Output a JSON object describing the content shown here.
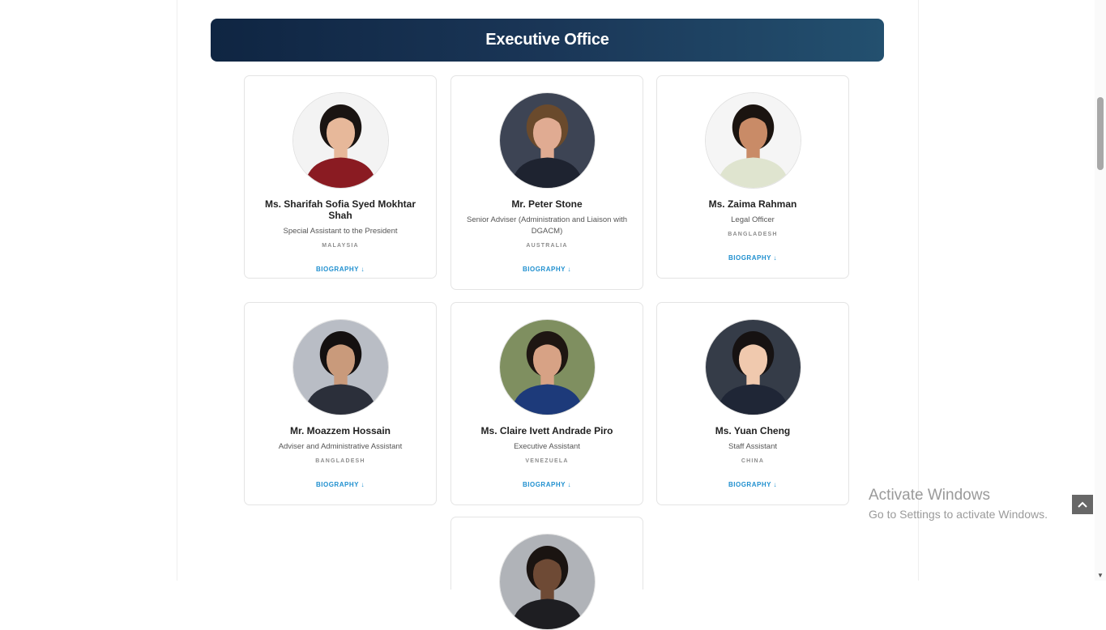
{
  "section": {
    "title": "Executive Office"
  },
  "people": [
    {
      "name": "Ms. Sharifah Sofia Syed Mokhtar Shah",
      "role": "Special Assistant to the President",
      "country": "MALAYSIA",
      "bio_label": "BIOGRAPHY ↓",
      "bg": "#f3f3f3",
      "skin": "#e7b89a",
      "hair": "#1a1412",
      "shirt": "#8a1b22"
    },
    {
      "name": "Mr. Peter Stone",
      "role": "Senior Adviser (Administration and Liaison with DGACM)",
      "country": "AUSTRALIA",
      "bio_label": "BIOGRAPHY ↓",
      "bg": "#3d4454",
      "skin": "#e0ab92",
      "hair": "#6a4a2c",
      "shirt": "#1e2330"
    },
    {
      "name": "Ms. Zaima Rahman",
      "role": "Legal Officer",
      "country": "BANGLADESH",
      "bio_label": "BIOGRAPHY ↓",
      "bg": "#f5f5f5",
      "skin": "#c98b67",
      "hair": "#1b1410",
      "shirt": "#dfe4cf"
    },
    {
      "name": "Mr. Moazzem Hossain",
      "role": "Adviser and Administrative Assistant",
      "country": "BANGLADESH",
      "bio_label": "BIOGRAPHY ↓",
      "bg": "#b9bdc5",
      "skin": "#c99a7b",
      "hair": "#141010",
      "shirt": "#2b2f3a"
    },
    {
      "name": "Ms. Claire Ivett Andrade Piro",
      "role": "Executive Assistant",
      "country": "VENEZUELA",
      "bio_label": "BIOGRAPHY ↓",
      "bg": "#7f8f60",
      "skin": "#d7a285",
      "hair": "#1e1612",
      "shirt": "#1d3a7a"
    },
    {
      "name": "Ms. Yuan Cheng",
      "role": "Staff Assistant",
      "country": "CHINA",
      "bio_label": "BIOGRAPHY ↓",
      "bg": "#353c48",
      "skin": "#f0c9ae",
      "hair": "#161212",
      "shirt": "#1f2636"
    },
    {
      "name": "",
      "role": "",
      "country": "",
      "bio_label": "",
      "bg": "#b0b3b8",
      "skin": "#6e4a35",
      "hair": "#1a1411",
      "shirt": "#1e1e22"
    }
  ],
  "watermark": {
    "title": "Activate Windows",
    "subtitle": "Go to Settings to activate Windows."
  }
}
